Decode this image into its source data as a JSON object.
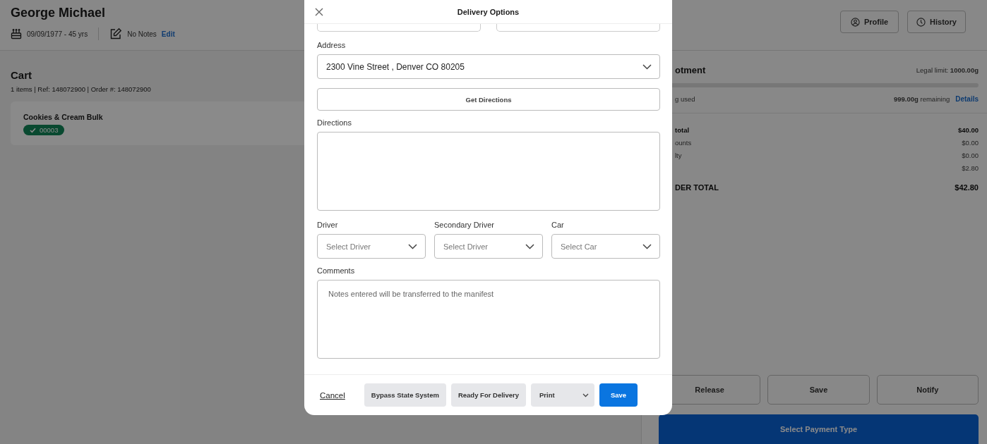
{
  "header": {
    "name": "George Michael",
    "birth": "09/09/1977 - 45 yrs",
    "notes": "No Notes",
    "edit_link": "Edit",
    "buttons": [
      {
        "kind": "profile",
        "label": "Profile"
      },
      {
        "kind": "history",
        "label": "History"
      }
    ]
  },
  "cart": {
    "title": "Cart",
    "summary": "1 items | Ref: 148072900 | Order #: 148072900",
    "items": [
      {
        "name": "Cookies & Cream Bulk",
        "badge": "00003",
        "verified": true
      }
    ]
  },
  "allotment": {
    "title": "otment",
    "legal_limit": "Legal limit: **1000.00g**",
    "used": "g used",
    "remaining": "**999.00g** remaining",
    "details_link": "Details"
  },
  "totals": [
    {
      "label": "total",
      "value": "$40.00",
      "bold": true
    },
    {
      "label": "ounts",
      "value": "$0.00",
      "bold": false
    },
    {
      "label": "lty",
      "value": "$0.00",
      "bold": false
    },
    {
      "value": "$2.80",
      "bold": false
    }
  ],
  "order_total": {
    "label": "DER TOTAL",
    "value": "$42.80"
  },
  "actions": [
    "Release",
    "Save",
    "Notify"
  ],
  "payment_button": "Select Payment Type",
  "modal": {
    "title": "Delivery Options",
    "address": {
      "label": "Address",
      "value": "2300 Vine Street , Denver CO 80205"
    },
    "get_directions": "Get Directions",
    "directions": {
      "label": "Directions"
    },
    "selects": [
      {
        "label": "Driver",
        "placeholder": "Select Driver"
      },
      {
        "label": "Secondary Driver",
        "placeholder": "Select Driver"
      },
      {
        "label": "Car",
        "placeholder": "Select Car"
      }
    ],
    "comments": {
      "label": "Comments",
      "placeholder": "Notes entered will be transferred to the manifest"
    },
    "cancel": "Cancel",
    "buttons": [
      "Bypass State System",
      "Ready For Delivery"
    ],
    "print": "Print",
    "save": "Save"
  }
}
